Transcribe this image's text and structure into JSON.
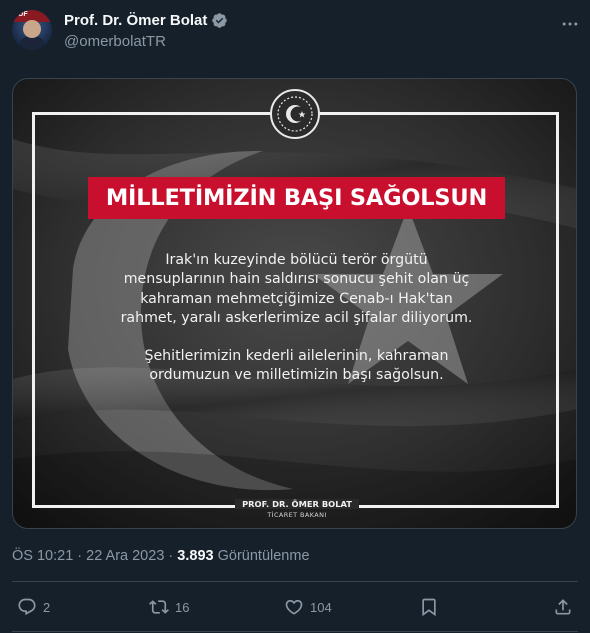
{
  "author": {
    "display_name": "Prof. Dr. Ömer Bolat",
    "handle": "@omerbolatTR",
    "avatar_text": "TUF"
  },
  "post": {
    "image": {
      "headline": "MİLLETİMİZİN BAŞI SAĞOLSUN",
      "message_paragraph_1": "Irak'ın kuzeyinde bölücü terör örgütü mensuplarının hain saldırısı sonucu şehit olan üç kahraman mehmetçiğimize Cenab-ı Hak'tan rahmet, yaralı askerlerimize acil şifalar diliyorum.",
      "message_paragraph_2": "Şehitlerimizin kederli ailelerinin, kahraman ordumuzun ve milletimizin başı sağolsun.",
      "signature_name": "PROF. DR. ÖMER BOLAT",
      "signature_title": "TİCARET BAKANI"
    },
    "time": "ÖS 10:21",
    "separator": "·",
    "date": "22 Ara 2023",
    "views_count": "3.893",
    "views_label": "Görüntülenme"
  },
  "actions": {
    "reply_count": "2",
    "repost_count": "16",
    "like_count": "104"
  },
  "icons": {
    "verified": "verified-badge-icon",
    "more": "more-icon",
    "reply": "reply-icon",
    "repost": "repost-icon",
    "like": "like-icon",
    "bookmark": "bookmark-icon",
    "share": "share-icon"
  },
  "colors": {
    "background": "#15202b",
    "primary_text": "#f7f9f9",
    "secondary_text": "#8b98a5",
    "verified": "#8b98a5",
    "headline_band": "#c8102e",
    "divider": "#38444d"
  }
}
